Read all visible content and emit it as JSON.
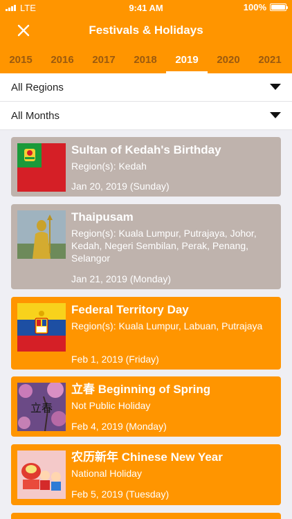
{
  "status_bar": {
    "carrier": "LTE",
    "time": "9:41 AM",
    "battery": "100%",
    "battery_level": 1.0
  },
  "nav": {
    "title": "Festivals & Holidays",
    "close_icon": "close-icon"
  },
  "years": [
    "2015",
    "2016",
    "2017",
    "2018",
    "2019",
    "2020",
    "2021"
  ],
  "selected_year": "2019",
  "filters": {
    "region": "All Regions",
    "month": "All Months"
  },
  "colors": {
    "accent": "#ff9500",
    "past_card": "#bfb3ad",
    "background": "#efeff4"
  },
  "holidays": [
    {
      "name": "Sultan of Kedah's Birthday",
      "region": "Region(s): Kedah",
      "date": "Jan 20, 2019 (Sunday)",
      "status": "past"
    },
    {
      "name": "Thaipusam",
      "region": "Region(s): Kuala Lumpur, Putrajaya, Johor, Kedah, Negeri Sembilan, Perak, Penang, Selangor",
      "date": "Jan 21, 2019 (Monday)",
      "status": "past"
    },
    {
      "name": "Federal Territory Day",
      "region": "Region(s): Kuala Lumpur, Labuan, Putrajaya",
      "date": "Feb 1, 2019 (Friday)",
      "status": "upcoming"
    },
    {
      "name": "立春 Beginning of Spring",
      "region": "Not Public Holiday",
      "date": "Feb 4, 2019 (Monday)",
      "status": "upcoming",
      "thumb_text": "立春"
    },
    {
      "name": "农历新年 Chinese New Year",
      "region": "National Holiday",
      "date": "Feb 5, 2019 (Tuesday)",
      "status": "upcoming"
    }
  ]
}
